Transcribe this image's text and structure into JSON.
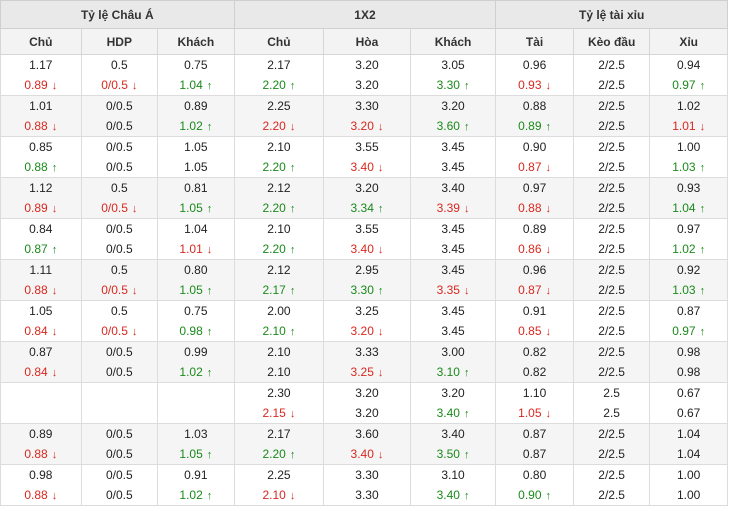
{
  "groups": [
    "Tỷ lệ Châu Á",
    "1X2",
    "Tỷ lệ tài xỉu"
  ],
  "columns": [
    "Chủ",
    "HDP",
    "Khách",
    "Chủ",
    "Hòa",
    "Khách",
    "Tài",
    "Kèo đầu",
    "Xỉu"
  ],
  "icons": {
    "up": "arrow-up-icon",
    "down": "arrow-down-icon"
  },
  "colors": {
    "up": "#1a8a1a",
    "down": "#d9281f",
    "header_bg": "#e9e9e9",
    "subheader_bg": "#f3f3f3",
    "alt_row_bg": "#f5f5f5"
  },
  "rows": [
    {
      "cells": [
        [
          {
            "v": "1.17",
            "d": ""
          },
          {
            "v": "0.89",
            "d": "down"
          }
        ],
        [
          {
            "v": "0.5",
            "d": ""
          },
          {
            "v": "0/0.5",
            "d": "down"
          }
        ],
        [
          {
            "v": "0.75",
            "d": ""
          },
          {
            "v": "1.04",
            "d": "up"
          }
        ],
        [
          {
            "v": "2.17",
            "d": ""
          },
          {
            "v": "2.20",
            "d": "up"
          }
        ],
        [
          {
            "v": "3.20",
            "d": ""
          },
          {
            "v": "3.20",
            "d": ""
          }
        ],
        [
          {
            "v": "3.05",
            "d": ""
          },
          {
            "v": "3.30",
            "d": "up"
          }
        ],
        [
          {
            "v": "0.96",
            "d": ""
          },
          {
            "v": "0.93",
            "d": "down"
          }
        ],
        [
          {
            "v": "2/2.5",
            "d": ""
          },
          {
            "v": "2/2.5",
            "d": ""
          }
        ],
        [
          {
            "v": "0.94",
            "d": ""
          },
          {
            "v": "0.97",
            "d": "up"
          }
        ]
      ]
    },
    {
      "cells": [
        [
          {
            "v": "1.01",
            "d": ""
          },
          {
            "v": "0.88",
            "d": "down"
          }
        ],
        [
          {
            "v": "0/0.5",
            "d": ""
          },
          {
            "v": "0/0.5",
            "d": ""
          }
        ],
        [
          {
            "v": "0.89",
            "d": ""
          },
          {
            "v": "1.02",
            "d": "up"
          }
        ],
        [
          {
            "v": "2.25",
            "d": ""
          },
          {
            "v": "2.20",
            "d": "down"
          }
        ],
        [
          {
            "v": "3.30",
            "d": ""
          },
          {
            "v": "3.20",
            "d": "down"
          }
        ],
        [
          {
            "v": "3.20",
            "d": ""
          },
          {
            "v": "3.60",
            "d": "up"
          }
        ],
        [
          {
            "v": "0.88",
            "d": ""
          },
          {
            "v": "0.89",
            "d": "up"
          }
        ],
        [
          {
            "v": "2/2.5",
            "d": ""
          },
          {
            "v": "2/2.5",
            "d": ""
          }
        ],
        [
          {
            "v": "1.02",
            "d": ""
          },
          {
            "v": "1.01",
            "d": "down"
          }
        ]
      ]
    },
    {
      "cells": [
        [
          {
            "v": "0.85",
            "d": ""
          },
          {
            "v": "0.88",
            "d": "up"
          }
        ],
        [
          {
            "v": "0/0.5",
            "d": ""
          },
          {
            "v": "0/0.5",
            "d": ""
          }
        ],
        [
          {
            "v": "1.05",
            "d": ""
          },
          {
            "v": "1.05",
            "d": ""
          }
        ],
        [
          {
            "v": "2.10",
            "d": ""
          },
          {
            "v": "2.20",
            "d": "up"
          }
        ],
        [
          {
            "v": "3.55",
            "d": ""
          },
          {
            "v": "3.40",
            "d": "down"
          }
        ],
        [
          {
            "v": "3.45",
            "d": ""
          },
          {
            "v": "3.45",
            "d": ""
          }
        ],
        [
          {
            "v": "0.90",
            "d": ""
          },
          {
            "v": "0.87",
            "d": "down"
          }
        ],
        [
          {
            "v": "2/2.5",
            "d": ""
          },
          {
            "v": "2/2.5",
            "d": ""
          }
        ],
        [
          {
            "v": "1.00",
            "d": ""
          },
          {
            "v": "1.03",
            "d": "up"
          }
        ]
      ]
    },
    {
      "cells": [
        [
          {
            "v": "1.12",
            "d": ""
          },
          {
            "v": "0.89",
            "d": "down"
          }
        ],
        [
          {
            "v": "0.5",
            "d": ""
          },
          {
            "v": "0/0.5",
            "d": "down"
          }
        ],
        [
          {
            "v": "0.81",
            "d": ""
          },
          {
            "v": "1.05",
            "d": "up"
          }
        ],
        [
          {
            "v": "2.12",
            "d": ""
          },
          {
            "v": "2.20",
            "d": "up"
          }
        ],
        [
          {
            "v": "3.20",
            "d": ""
          },
          {
            "v": "3.34",
            "d": "up"
          }
        ],
        [
          {
            "v": "3.40",
            "d": ""
          },
          {
            "v": "3.39",
            "d": "down"
          }
        ],
        [
          {
            "v": "0.97",
            "d": ""
          },
          {
            "v": "0.88",
            "d": "down"
          }
        ],
        [
          {
            "v": "2/2.5",
            "d": ""
          },
          {
            "v": "2/2.5",
            "d": ""
          }
        ],
        [
          {
            "v": "0.93",
            "d": ""
          },
          {
            "v": "1.04",
            "d": "up"
          }
        ]
      ]
    },
    {
      "cells": [
        [
          {
            "v": "0.84",
            "d": ""
          },
          {
            "v": "0.87",
            "d": "up"
          }
        ],
        [
          {
            "v": "0/0.5",
            "d": ""
          },
          {
            "v": "0/0.5",
            "d": ""
          }
        ],
        [
          {
            "v": "1.04",
            "d": ""
          },
          {
            "v": "1.01",
            "d": "down"
          }
        ],
        [
          {
            "v": "2.10",
            "d": ""
          },
          {
            "v": "2.20",
            "d": "up"
          }
        ],
        [
          {
            "v": "3.55",
            "d": ""
          },
          {
            "v": "3.40",
            "d": "down"
          }
        ],
        [
          {
            "v": "3.45",
            "d": ""
          },
          {
            "v": "3.45",
            "d": ""
          }
        ],
        [
          {
            "v": "0.89",
            "d": ""
          },
          {
            "v": "0.86",
            "d": "down"
          }
        ],
        [
          {
            "v": "2/2.5",
            "d": ""
          },
          {
            "v": "2/2.5",
            "d": ""
          }
        ],
        [
          {
            "v": "0.97",
            "d": ""
          },
          {
            "v": "1.02",
            "d": "up"
          }
        ]
      ]
    },
    {
      "cells": [
        [
          {
            "v": "1.11",
            "d": ""
          },
          {
            "v": "0.88",
            "d": "down"
          }
        ],
        [
          {
            "v": "0.5",
            "d": ""
          },
          {
            "v": "0/0.5",
            "d": "down"
          }
        ],
        [
          {
            "v": "0.80",
            "d": ""
          },
          {
            "v": "1.05",
            "d": "up"
          }
        ],
        [
          {
            "v": "2.12",
            "d": ""
          },
          {
            "v": "2.17",
            "d": "up"
          }
        ],
        [
          {
            "v": "2.95",
            "d": ""
          },
          {
            "v": "3.30",
            "d": "up"
          }
        ],
        [
          {
            "v": "3.45",
            "d": ""
          },
          {
            "v": "3.35",
            "d": "down"
          }
        ],
        [
          {
            "v": "0.96",
            "d": ""
          },
          {
            "v": "0.87",
            "d": "down"
          }
        ],
        [
          {
            "v": "2/2.5",
            "d": ""
          },
          {
            "v": "2/2.5",
            "d": ""
          }
        ],
        [
          {
            "v": "0.92",
            "d": ""
          },
          {
            "v": "1.03",
            "d": "up"
          }
        ]
      ]
    },
    {
      "cells": [
        [
          {
            "v": "1.05",
            "d": ""
          },
          {
            "v": "0.84",
            "d": "down"
          }
        ],
        [
          {
            "v": "0.5",
            "d": ""
          },
          {
            "v": "0/0.5",
            "d": "down"
          }
        ],
        [
          {
            "v": "0.75",
            "d": ""
          },
          {
            "v": "0.98",
            "d": "up"
          }
        ],
        [
          {
            "v": "2.00",
            "d": ""
          },
          {
            "v": "2.10",
            "d": "up"
          }
        ],
        [
          {
            "v": "3.25",
            "d": ""
          },
          {
            "v": "3.20",
            "d": "down"
          }
        ],
        [
          {
            "v": "3.45",
            "d": ""
          },
          {
            "v": "3.45",
            "d": ""
          }
        ],
        [
          {
            "v": "0.91",
            "d": ""
          },
          {
            "v": "0.85",
            "d": "down"
          }
        ],
        [
          {
            "v": "2/2.5",
            "d": ""
          },
          {
            "v": "2/2.5",
            "d": ""
          }
        ],
        [
          {
            "v": "0.87",
            "d": ""
          },
          {
            "v": "0.97",
            "d": "up"
          }
        ]
      ]
    },
    {
      "cells": [
        [
          {
            "v": "0.87",
            "d": ""
          },
          {
            "v": "0.84",
            "d": "down"
          }
        ],
        [
          {
            "v": "0/0.5",
            "d": ""
          },
          {
            "v": "0/0.5",
            "d": ""
          }
        ],
        [
          {
            "v": "0.99",
            "d": ""
          },
          {
            "v": "1.02",
            "d": "up"
          }
        ],
        [
          {
            "v": "2.10",
            "d": ""
          },
          {
            "v": "2.10",
            "d": ""
          }
        ],
        [
          {
            "v": "3.33",
            "d": ""
          },
          {
            "v": "3.25",
            "d": "down"
          }
        ],
        [
          {
            "v": "3.00",
            "d": ""
          },
          {
            "v": "3.10",
            "d": "up"
          }
        ],
        [
          {
            "v": "0.82",
            "d": ""
          },
          {
            "v": "0.82",
            "d": ""
          }
        ],
        [
          {
            "v": "2/2.5",
            "d": ""
          },
          {
            "v": "2/2.5",
            "d": ""
          }
        ],
        [
          {
            "v": "0.98",
            "d": ""
          },
          {
            "v": "0.98",
            "d": ""
          }
        ]
      ]
    },
    {
      "cells": [
        [
          {
            "v": "",
            "d": ""
          },
          {
            "v": "",
            "d": ""
          }
        ],
        [
          {
            "v": "",
            "d": ""
          },
          {
            "v": "",
            "d": ""
          }
        ],
        [
          {
            "v": "",
            "d": ""
          },
          {
            "v": "",
            "d": ""
          }
        ],
        [
          {
            "v": "2.30",
            "d": ""
          },
          {
            "v": "2.15",
            "d": "down"
          }
        ],
        [
          {
            "v": "3.20",
            "d": ""
          },
          {
            "v": "3.20",
            "d": ""
          }
        ],
        [
          {
            "v": "3.20",
            "d": ""
          },
          {
            "v": "3.40",
            "d": "up"
          }
        ],
        [
          {
            "v": "1.10",
            "d": ""
          },
          {
            "v": "1.05",
            "d": "down"
          }
        ],
        [
          {
            "v": "2.5",
            "d": ""
          },
          {
            "v": "2.5",
            "d": ""
          }
        ],
        [
          {
            "v": "0.67",
            "d": ""
          },
          {
            "v": "0.67",
            "d": ""
          }
        ]
      ]
    },
    {
      "cells": [
        [
          {
            "v": "0.89",
            "d": ""
          },
          {
            "v": "0.88",
            "d": "down"
          }
        ],
        [
          {
            "v": "0/0.5",
            "d": ""
          },
          {
            "v": "0/0.5",
            "d": ""
          }
        ],
        [
          {
            "v": "1.03",
            "d": ""
          },
          {
            "v": "1.05",
            "d": "up"
          }
        ],
        [
          {
            "v": "2.17",
            "d": ""
          },
          {
            "v": "2.20",
            "d": "up"
          }
        ],
        [
          {
            "v": "3.60",
            "d": ""
          },
          {
            "v": "3.40",
            "d": "down"
          }
        ],
        [
          {
            "v": "3.40",
            "d": ""
          },
          {
            "v": "3.50",
            "d": "up"
          }
        ],
        [
          {
            "v": "0.87",
            "d": ""
          },
          {
            "v": "0.87",
            "d": ""
          }
        ],
        [
          {
            "v": "2/2.5",
            "d": ""
          },
          {
            "v": "2/2.5",
            "d": ""
          }
        ],
        [
          {
            "v": "1.04",
            "d": ""
          },
          {
            "v": "1.04",
            "d": ""
          }
        ]
      ]
    },
    {
      "cells": [
        [
          {
            "v": "0.98",
            "d": ""
          },
          {
            "v": "0.88",
            "d": "down"
          }
        ],
        [
          {
            "v": "0/0.5",
            "d": ""
          },
          {
            "v": "0/0.5",
            "d": ""
          }
        ],
        [
          {
            "v": "0.91",
            "d": ""
          },
          {
            "v": "1.02",
            "d": "up"
          }
        ],
        [
          {
            "v": "2.25",
            "d": ""
          },
          {
            "v": "2.10",
            "d": "down"
          }
        ],
        [
          {
            "v": "3.30",
            "d": ""
          },
          {
            "v": "3.30",
            "d": ""
          }
        ],
        [
          {
            "v": "3.10",
            "d": ""
          },
          {
            "v": "3.40",
            "d": "up"
          }
        ],
        [
          {
            "v": "0.80",
            "d": ""
          },
          {
            "v": "0.90",
            "d": "up"
          }
        ],
        [
          {
            "v": "2/2.5",
            "d": ""
          },
          {
            "v": "2/2.5",
            "d": ""
          }
        ],
        [
          {
            "v": "1.00",
            "d": ""
          },
          {
            "v": "1.00",
            "d": ""
          }
        ]
      ]
    }
  ]
}
